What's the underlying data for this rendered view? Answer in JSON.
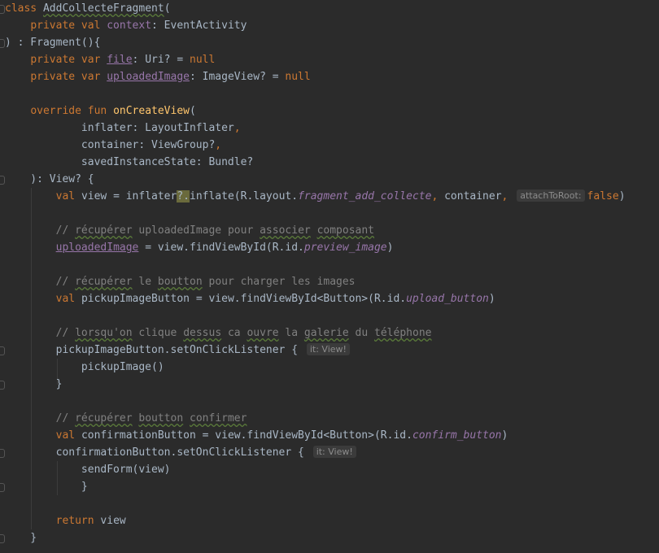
{
  "editor": {
    "lines": [
      "class AddCollecteFragment(",
      "    private val context: EventActivity",
      ") : Fragment(){",
      "    private var file: Uri? = null",
      "    private var uploadedImage: ImageView? = null",
      "",
      "    override fun onCreateView(",
      "            inflater: LayoutInflater,",
      "            container: ViewGroup?,",
      "            savedInstanceState: Bundle?",
      "    ): View? {",
      "        val view = inflater?.inflate(R.layout.fragment_add_collecte, container, attachToRoot: false)",
      "",
      "        // récupérer uploadedImage pour associer composant",
      "        uploadedImage = view.findViewById(R.id.preview_image)",
      "",
      "        // récupérer le boutton pour charger les images",
      "        val pickupImageButton = view.findViewById<Button>(R.id.upload_button)",
      "",
      "        // lorsqu'on clique dessus ca ouvre la galerie du téléphone",
      "        pickupImageButton.setOnClickListener { it: View!",
      "            pickupImage()",
      "        }",
      "",
      "        // récupérer boutton confirmer",
      "        val confirmationButton = view.findViewById<Button>(R.id.confirm_button)",
      "        confirmationButton.setOnClickListener { it: View!",
      "            sendForm(view)",
      "            }",
      "",
      "        return view",
      "    }"
    ],
    "hints": {
      "attach_to_root": "attachToRoot:",
      "it_view": "it: View!"
    }
  }
}
